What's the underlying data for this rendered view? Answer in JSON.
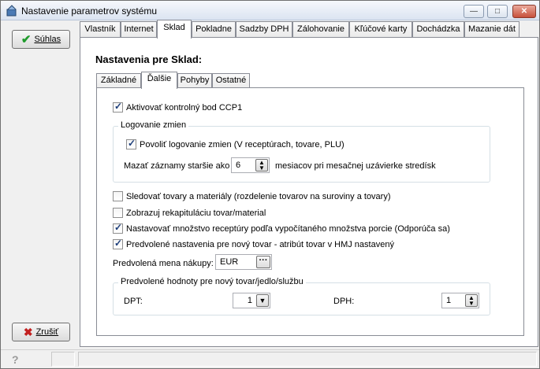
{
  "window": {
    "title": "Nastavenie parametrov systému"
  },
  "buttons": {
    "ok": "Súhlas",
    "cancel": "Zrušiť"
  },
  "main_tabs": [
    "Vlastník",
    "Internet",
    "Sklad",
    "Pokladne",
    "Sadzby DPH",
    "Zálohovanie",
    "Kľúčové karty",
    "Dochádzka",
    "Mazanie dát"
  ],
  "active_main_tab": "Sklad",
  "heading": "Nastavenia pre Sklad:",
  "sub_tabs": [
    "Základné",
    "Ďalšie",
    "Pohyby",
    "Ostatné"
  ],
  "active_sub_tab": "Ďalšie",
  "settings": {
    "ccp1": {
      "label": "Aktivovať kontrolný bod CCP1",
      "checked": true
    },
    "logging_group": {
      "title": "Logovanie zmien",
      "enable": {
        "label": "Povoliť logovanie zmien (V receptúrach, tovare, PLU)",
        "checked": true
      },
      "delete_label": "Mazať záznamy staršie ako",
      "months_value": "6",
      "months_suffix": "mesiacov pri mesačnej uzávierke stredísk"
    },
    "track_goods": {
      "label": "Sledovať tovary a materiály (rozdelenie tovarov na suroviny a tovary)",
      "checked": false
    },
    "show_recap": {
      "label": "Zobrazuj rekapituláciu tovar/material",
      "checked": false
    },
    "set_quantity": {
      "label": "Nastavovať množstvo receptúry podľa vypočítaného množstva porcie (Odporúča sa)",
      "checked": true
    },
    "default_new_goods": {
      "label": "Predvolené nastavenia pre nový tovar - atribút tovar v HMJ nastavený",
      "checked": true
    },
    "currency_label": "Predvolená mena nákupy:",
    "currency_value": "EUR",
    "defaults_group": {
      "title": "Predvolené hodnoty pre nový tovar/jedlo/službu",
      "dpt_label": "DPT:",
      "dpt_value": "1",
      "dph_label": "DPH:",
      "dph_value": "1"
    }
  },
  "status": {
    "help": "?"
  }
}
